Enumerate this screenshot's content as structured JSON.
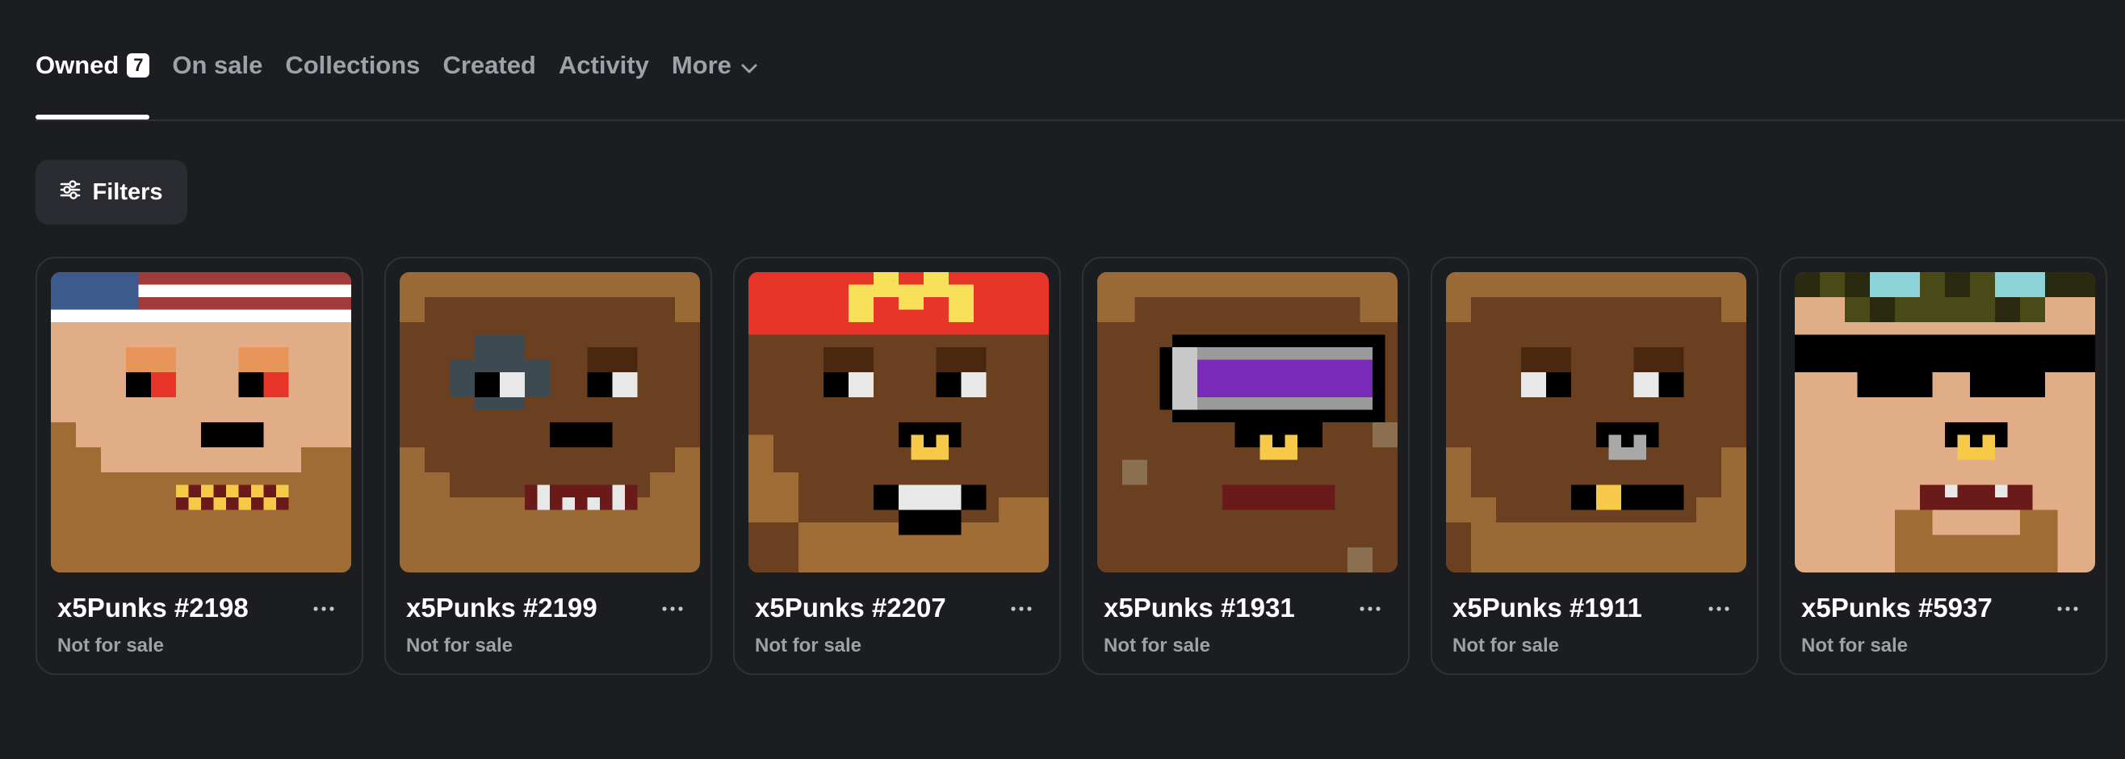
{
  "tabs": [
    {
      "label": "Owned",
      "count": "7",
      "active": true
    },
    {
      "label": "On sale"
    },
    {
      "label": "Collections"
    },
    {
      "label": "Created"
    },
    {
      "label": "Activity"
    },
    {
      "label": "More",
      "icon": "chevron-down-icon"
    }
  ],
  "filters": {
    "label": "Filters",
    "icon": "sliders-icon"
  },
  "cards": [
    {
      "name": "x5Punks #2198",
      "status": "Not for sale"
    },
    {
      "name": "x5Punks #2199",
      "status": "Not for sale"
    },
    {
      "name": "x5Punks #2207",
      "status": "Not for sale"
    },
    {
      "name": "x5Punks #1931",
      "status": "Not for sale"
    },
    {
      "name": "x5Punks #1911",
      "status": "Not for sale"
    },
    {
      "name": "x5Punks #5937",
      "status": "Not for sale"
    }
  ],
  "colors": {
    "background": "#1c1d21",
    "text": "#ffffff",
    "muted": "#9ea1a8",
    "border": "#2f3136"
  }
}
